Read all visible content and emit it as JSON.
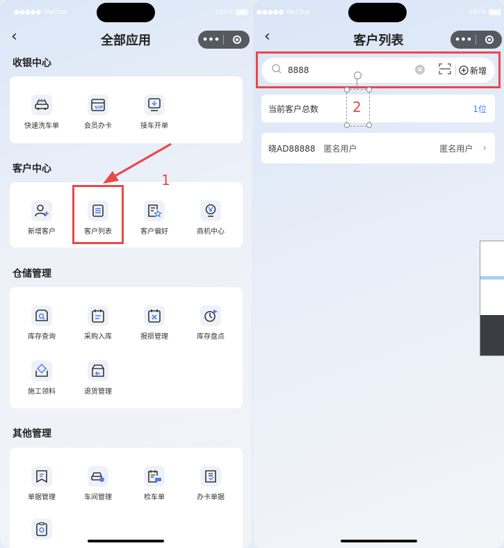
{
  "left": {
    "status": {
      "carrier": "●●●●● WeChat",
      "battery": "100%"
    },
    "title": "全部应用",
    "sections": [
      {
        "title": "收银中心",
        "apps": [
          {
            "label": "快速洗车单",
            "icon": "car-wash-icon"
          },
          {
            "label": "会员办卡",
            "icon": "vip-card-icon"
          },
          {
            "label": "接车开单",
            "icon": "reception-icon"
          }
        ]
      },
      {
        "title": "客户中心",
        "apps": [
          {
            "label": "新增客户",
            "icon": "add-user-icon"
          },
          {
            "label": "客户列表",
            "icon": "list-icon"
          },
          {
            "label": "客户偏好",
            "icon": "preference-icon"
          },
          {
            "label": "商机中心",
            "icon": "opportunity-icon"
          }
        ]
      },
      {
        "title": "仓储管理",
        "apps": [
          {
            "label": "库存查询",
            "icon": "inventory-search-icon"
          },
          {
            "label": "采购入库",
            "icon": "purchase-icon"
          },
          {
            "label": "报损管理",
            "icon": "damage-icon"
          },
          {
            "label": "库存盘点",
            "icon": "stocktake-icon"
          },
          {
            "label": "施工领料",
            "icon": "material-icon"
          },
          {
            "label": "退货管理",
            "icon": "return-icon"
          }
        ]
      },
      {
        "title": "其他管理",
        "apps": [
          {
            "label": "单据管理",
            "icon": "document-icon"
          },
          {
            "label": "车间管理",
            "icon": "workshop-icon"
          },
          {
            "label": "检车单",
            "icon": "inspection-icon"
          },
          {
            "label": "办卡单据",
            "icon": "card-document-icon"
          }
        ]
      }
    ],
    "annotation": "1"
  },
  "right": {
    "status": {
      "carrier": "●●●●● WeChat",
      "battery": "100%"
    },
    "title": "客户列表",
    "search": {
      "value": "8888",
      "add_label": "新增"
    },
    "total": {
      "label": "当前客户总数",
      "value": "1位"
    },
    "customer": {
      "plate": "晓AD88888",
      "name": "匿名用户",
      "type": "匿名用户"
    },
    "annotation": "2"
  },
  "colors": {
    "accent": "#4a7df0",
    "highlight": "#e9474b"
  }
}
